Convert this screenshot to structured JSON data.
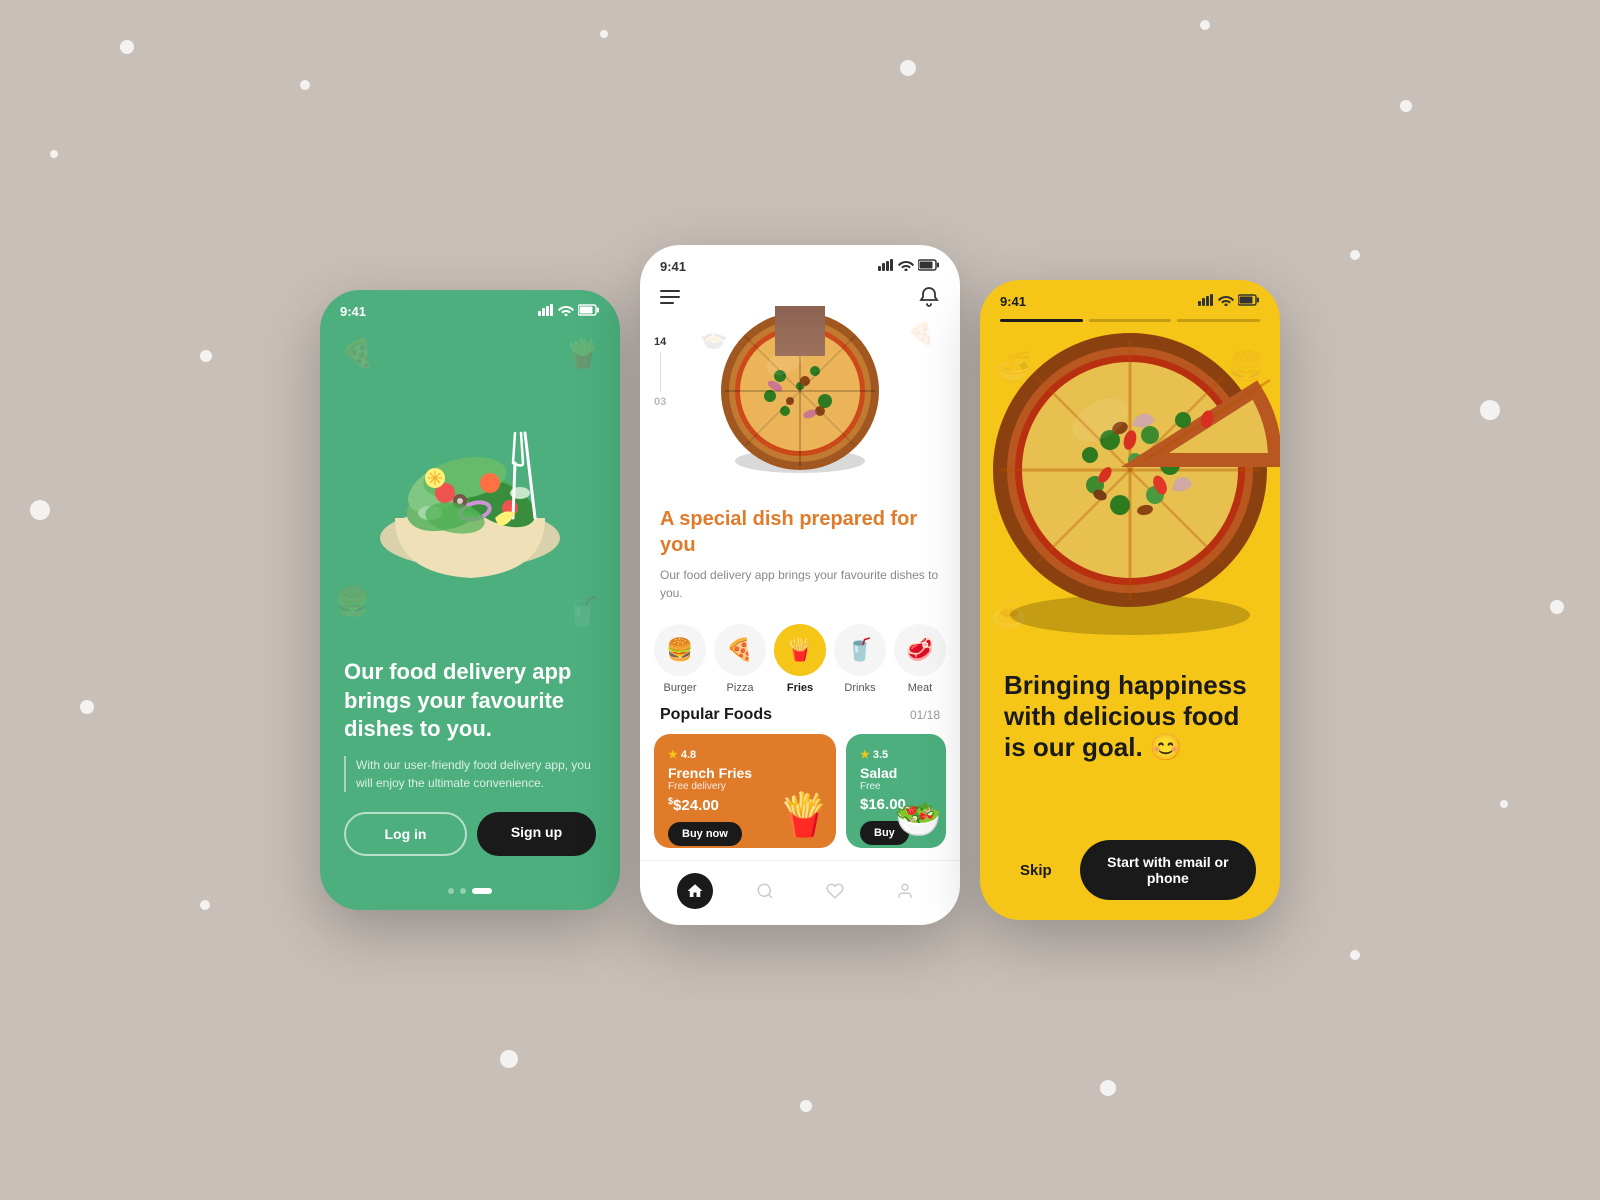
{
  "background": "#c8bfb8",
  "phone1": {
    "status_time": "9:41",
    "headline": "Our food delivery app brings your favourite dishes to you.",
    "subtitle": "With our user-friendly food delivery app, you will enjoy the ultimate convenience.",
    "login_label": "Log in",
    "signup_label": "Sign up",
    "dots": [
      false,
      false,
      true
    ]
  },
  "phone2": {
    "status_time": "9:41",
    "slide_top": "14",
    "slide_bottom": "03",
    "headline_normal": "A ",
    "headline_accent": "special dish",
    "headline_end": " prepared for you",
    "subtitle": "Our food delivery app brings your favourite dishes to you.",
    "categories": [
      {
        "icon": "🍔",
        "label": "Burger",
        "active": false
      },
      {
        "icon": "🍕",
        "label": "Pizza",
        "active": false
      },
      {
        "icon": "🍟",
        "label": "Fries",
        "active": true
      },
      {
        "icon": "🥤",
        "label": "Drinks",
        "active": false
      },
      {
        "icon": "🥩",
        "label": "Meat",
        "active": false
      }
    ],
    "popular_label": "Popular Foods",
    "popular_count": "01/18",
    "card1": {
      "rating": "4.8",
      "name": "French Fries",
      "delivery": "Free delivery",
      "price": "$24.00",
      "buy_label": "Buy now",
      "color": "#e07b2a"
    },
    "card2": {
      "rating": "3.5",
      "name": "Salad",
      "delivery": "Free",
      "price": "$16.00",
      "buy_label": "Buy",
      "color": "#4caf7d"
    }
  },
  "phone3": {
    "status_time": "9:41",
    "headline": "Bringing happiness with delicious food is our goal.",
    "emoji": "😊",
    "skip_label": "Skip",
    "start_label": "Start with email or phone"
  }
}
